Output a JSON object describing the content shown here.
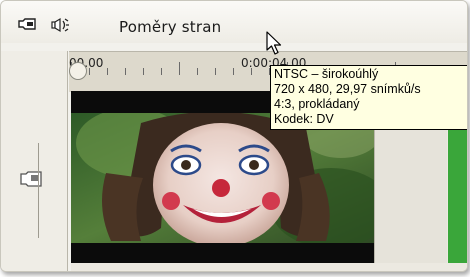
{
  "toolbar": {
    "title": "Poměry stran",
    "icons": [
      "video-track-icon",
      "audio-speaker-icon"
    ]
  },
  "ruler": {
    "labels": [
      "00.00",
      "0:00:04.00"
    ]
  },
  "tooltip": {
    "lines": [
      "NTSC – širokoúhlý",
      "720 x 480, 29,97 snímků/s",
      "4:3, prokládaný",
      "Kodek: DV"
    ]
  },
  "colors": {
    "tooltip_bg": "#ffffe1",
    "next_clip": "#3aa63a",
    "window_bg": "#f2f1ec"
  }
}
